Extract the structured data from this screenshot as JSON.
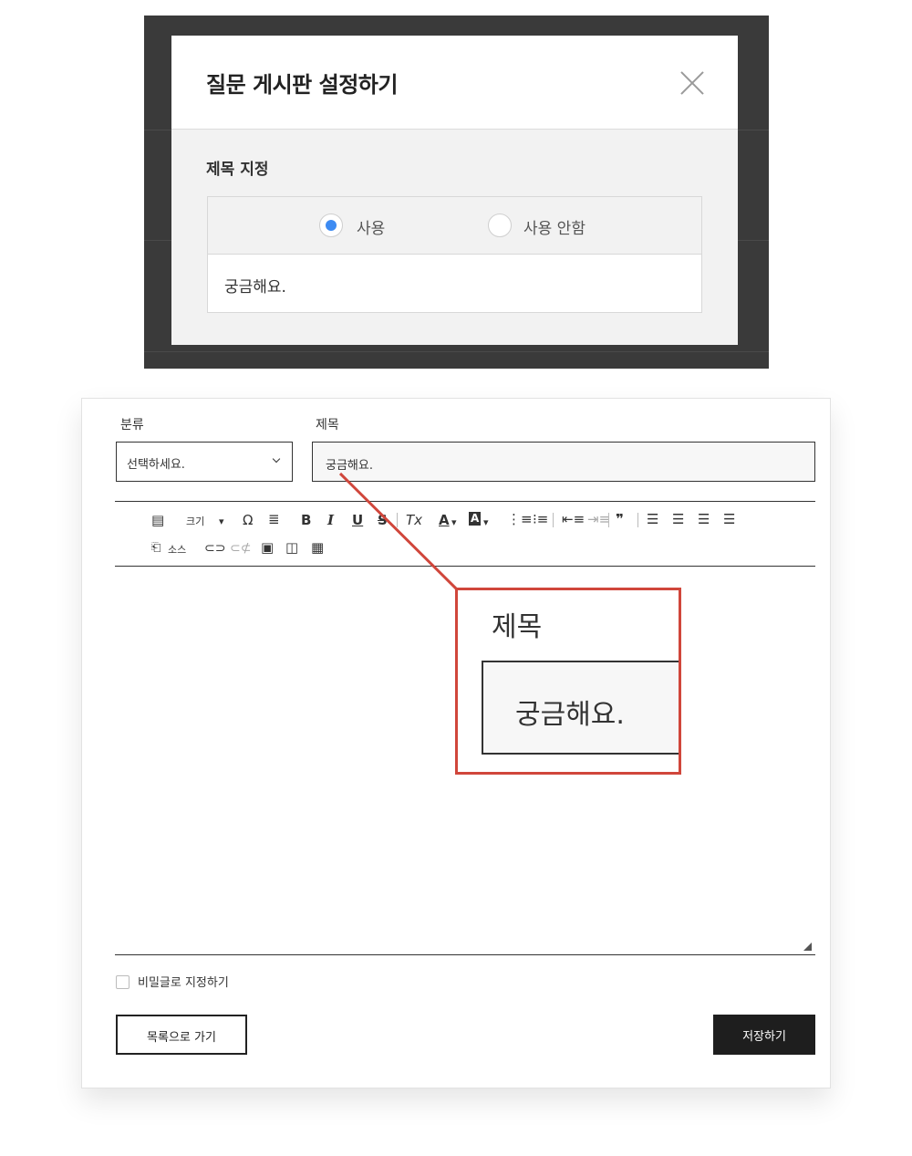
{
  "modal": {
    "title": "질문 게시판 설정하기",
    "section_label": "제목 지정",
    "options": [
      {
        "label": "사용",
        "selected": true
      },
      {
        "label": "사용 안함",
        "selected": false
      }
    ],
    "title_value": "궁금해요."
  },
  "form": {
    "category_label": "분류",
    "category_value": "선택하세요.",
    "title_label": "제목",
    "title_value": "궁금해요.",
    "toolbar": {
      "size_label": "크기",
      "omega": "Ω",
      "bold": "B",
      "italic": "I",
      "underline": "U",
      "strike": "S",
      "clear_format": "Tx",
      "text_color": "A",
      "bg_color": "A",
      "blockquote": "❞",
      "source_label": "소스"
    },
    "secret_label": "비밀글로 지정하기",
    "secret_checked": false,
    "back_button": "목록으로 가기",
    "save_button": "저장하기"
  },
  "callout": {
    "label": "제목",
    "value": "궁금해요.",
    "color": "#d0463b"
  },
  "colors": {
    "accent": "#3d8bf2",
    "save_button_bg": "#1e1e1e"
  }
}
